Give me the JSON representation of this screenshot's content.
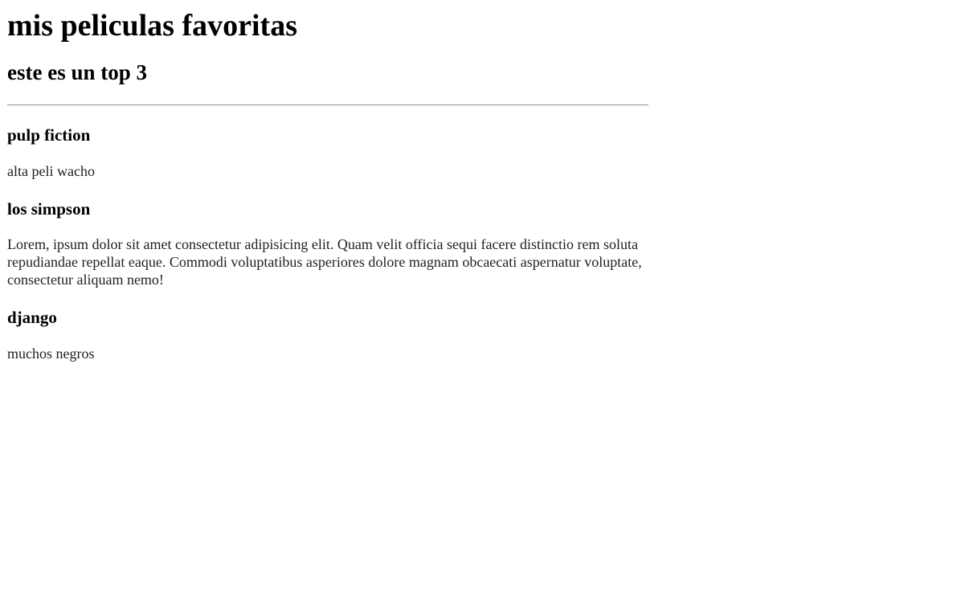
{
  "header": {
    "title": "mis peliculas favoritas",
    "subtitle": "este es un top 3"
  },
  "movies": [
    {
      "title": "pulp fiction",
      "description": "alta peli wacho"
    },
    {
      "title": "los simpson",
      "description": "Lorem, ipsum dolor sit amet consectetur adipisicing elit. Quam velit officia sequi facere distinctio rem soluta repudiandae repellat eaque. Commodi voluptatibus asperiores dolore magnam obcaecati aspernatur voluptate, consectetur aliquam nemo!"
    },
    {
      "title": "django",
      "description": "muchos negros"
    }
  ]
}
